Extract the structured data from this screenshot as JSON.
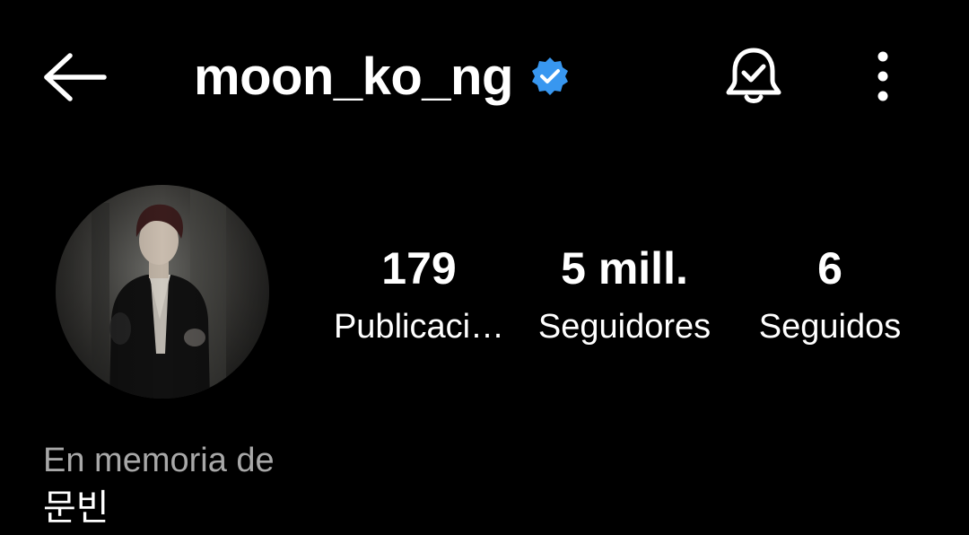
{
  "header": {
    "username": "moon_ko_ng",
    "verified": true,
    "icons": {
      "back": "arrow-left-icon",
      "verified": "verified-badge-icon",
      "notifications": "bell-check-icon",
      "more": "more-vertical-icon"
    },
    "accent_color": "#3897f0"
  },
  "profile": {
    "avatar": "profile-photo",
    "stats": [
      {
        "value": "179",
        "label": "Publicaci…"
      },
      {
        "value": "5 mill.",
        "label": "Seguidores"
      },
      {
        "value": "6",
        "label": "Seguidos"
      }
    ],
    "bio": {
      "line1": "En memoria de",
      "line2": "문빈"
    }
  },
  "colors": {
    "background": "#000000",
    "text": "#ffffff",
    "secondary_text": "#a8a8a8"
  }
}
